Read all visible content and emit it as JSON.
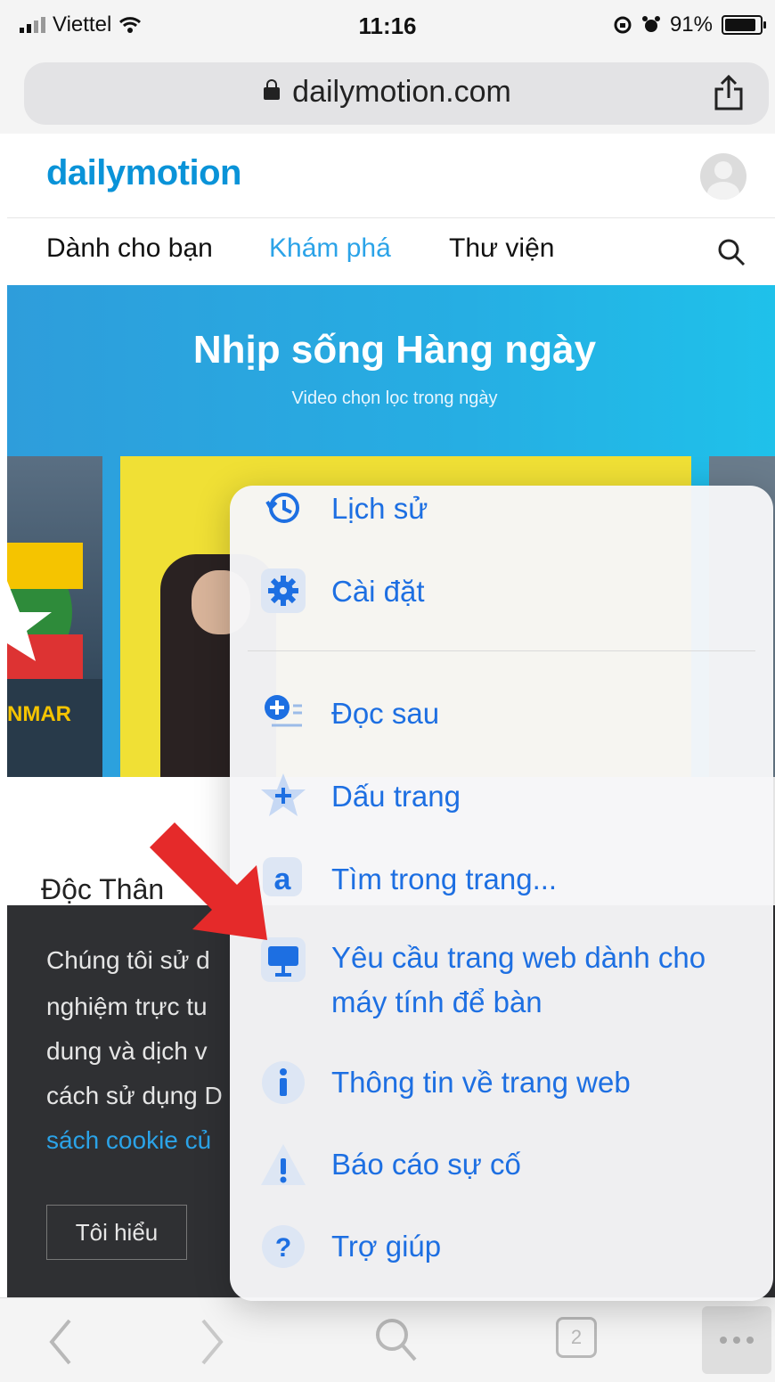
{
  "status": {
    "carrier": "Viettel",
    "time": "11:16",
    "battery": "91%"
  },
  "browser": {
    "url": "dailymotion.com",
    "tab_count": "2"
  },
  "site": {
    "logo": "dailymotion",
    "nav": [
      "Dành cho bạn",
      "Khám phá",
      "Thư viện"
    ],
    "banner_title": "Nhịp sống Hàng ngày",
    "banner_subtitle": "Video chọn lọc trong ngày",
    "thumb_label": "NMAR",
    "section_title": "Độc Thân",
    "cookie_lines": [
      "Chúng tôi sử d",
      "nghiệm trực tu",
      "dung và dịch v",
      "cách sử dụng D"
    ],
    "cookie_link": "sách cookie củ",
    "cookie_button": "Tôi hiểu"
  },
  "menu": {
    "items": [
      {
        "label": "Lịch sử",
        "icon": "history-icon"
      },
      {
        "label": "Cài đặt",
        "icon": "gear-icon"
      },
      {
        "label": "Đọc sau",
        "icon": "reading-list-icon"
      },
      {
        "label": "Dấu trang",
        "icon": "bookmark-star-icon"
      },
      {
        "label": "Tìm trong trang...",
        "icon": "find-in-page-icon"
      },
      {
        "label": "Yêu cầu trang web dành cho",
        "label2": "máy tính để bàn",
        "icon": "desktop-icon"
      },
      {
        "label": "Thông tin về trang web",
        "icon": "info-icon"
      },
      {
        "label": "Báo cáo sự cố",
        "icon": "warning-icon"
      },
      {
        "label": "Trợ giúp",
        "icon": "help-icon"
      }
    ]
  },
  "colors": {
    "accent": "#1d6fe2",
    "brand": "#0a93d8",
    "arrow": "#e52a2a"
  }
}
